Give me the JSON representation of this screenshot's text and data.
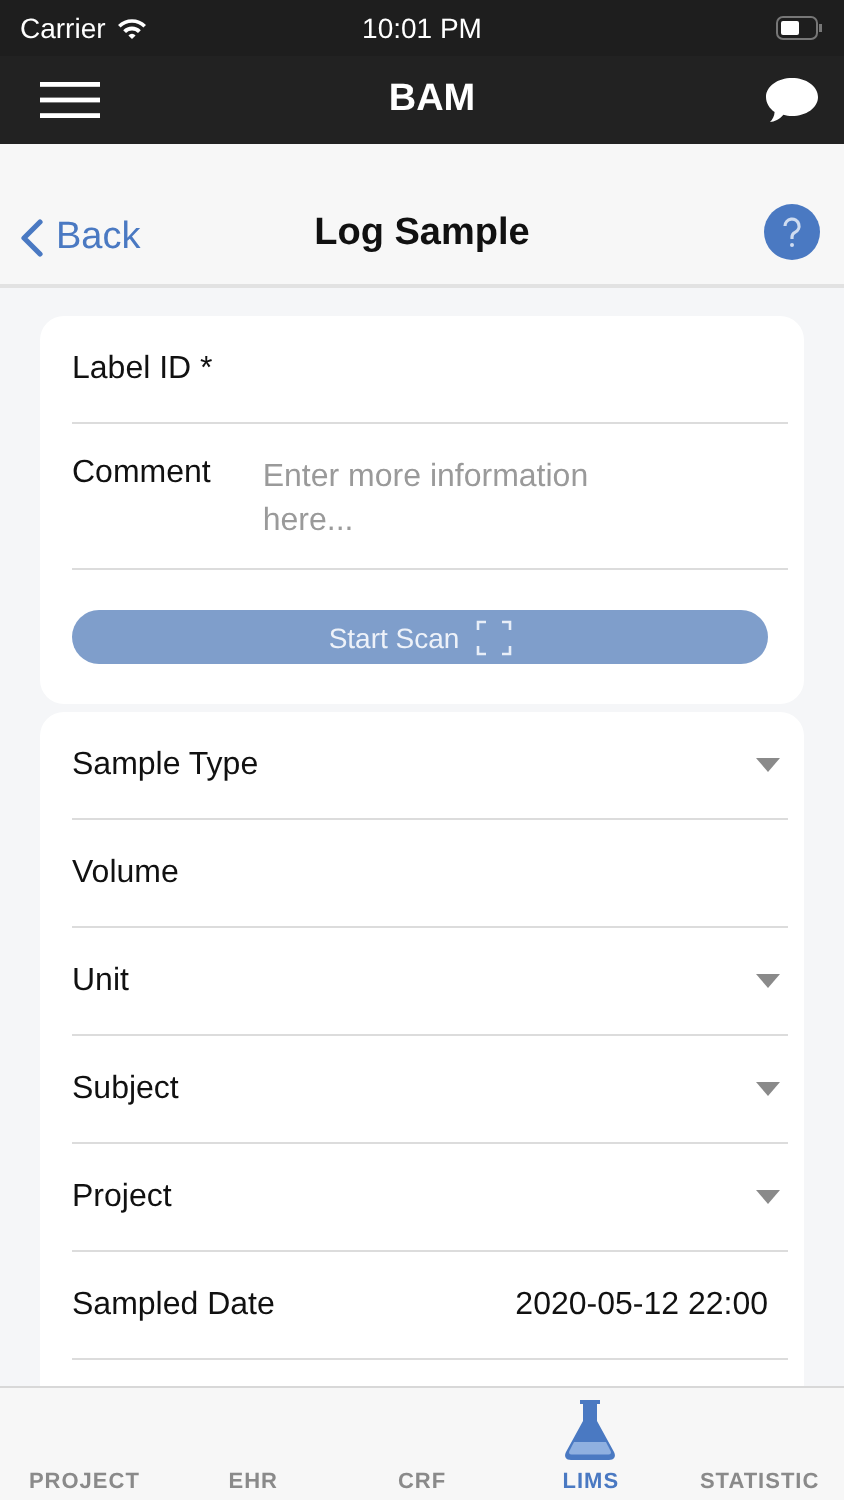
{
  "status_bar": {
    "carrier": "Carrier",
    "time": "10:01 PM"
  },
  "app_bar": {
    "title": "BAM"
  },
  "header": {
    "back": "Back",
    "title": "Log Sample"
  },
  "sample_card": {
    "fields": [
      {
        "kind": "text",
        "label": "Label ID *"
      },
      {
        "kind": "textarea",
        "label": "Comment",
        "placeholder": "Enter more information here..."
      }
    ],
    "scan_button": "Start Scan"
  },
  "details_card": {
    "fields": [
      {
        "kind": "select",
        "label": "Sample Type"
      },
      {
        "kind": "text",
        "label": "Volume"
      },
      {
        "kind": "select",
        "label": "Unit"
      },
      {
        "kind": "select",
        "label": "Subject"
      },
      {
        "kind": "select",
        "label": "Project"
      },
      {
        "kind": "value",
        "label": "Sampled Date",
        "value": "2020-05-12 22:00"
      }
    ]
  },
  "tabs": [
    {
      "label": "PROJECT",
      "selected": false
    },
    {
      "label": "EHR",
      "selected": false
    },
    {
      "label": "CRF",
      "selected": false
    },
    {
      "label": "LIMS",
      "selected": true
    },
    {
      "label": "STATISTIC",
      "selected": false
    }
  ]
}
